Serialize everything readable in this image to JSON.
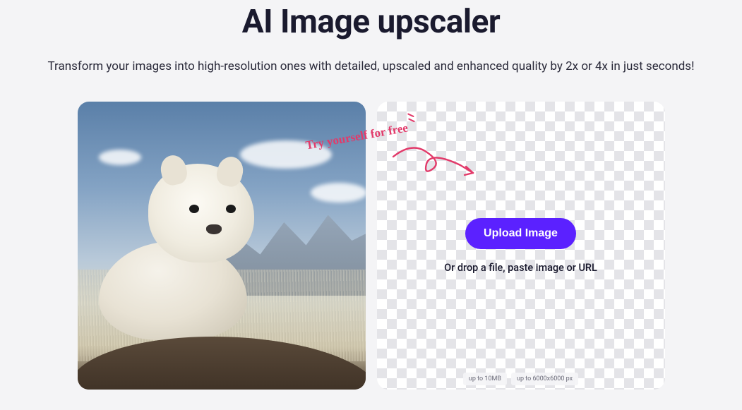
{
  "header": {
    "title": "AI Image upscaler",
    "subtitle": "Transform your images into high-resolution ones with detailed, upscaled and enhanced quality by 2x or 4x in just seconds!"
  },
  "callout": {
    "try_text": "Try yourself for free"
  },
  "upload": {
    "button_label": "Upload Image",
    "drop_hint": "Or drop a file, paste image or URL",
    "limit_filesize": "up to 10MB",
    "limit_dimensions": "up to 6000x6000 px"
  },
  "colors": {
    "accent": "#5b21ff",
    "callout": "#e23a6a"
  }
}
